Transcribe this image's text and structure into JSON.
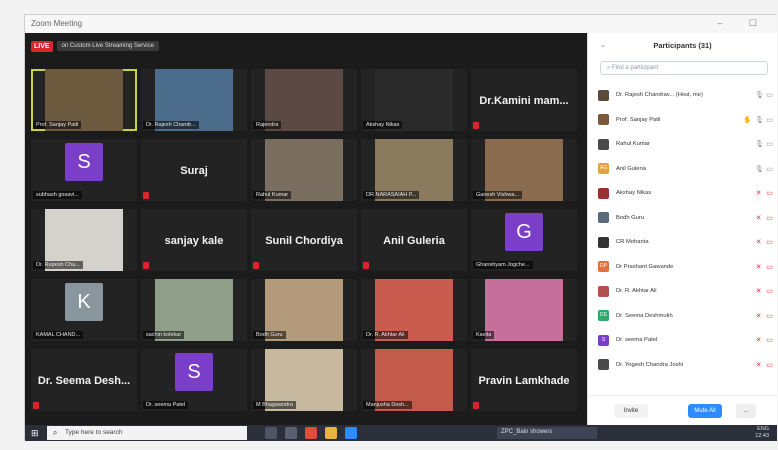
{
  "window": {
    "title": "Zoom Meeting"
  },
  "video": {
    "live_badge": "LIVE",
    "stream_label": "on Custom Live Streaming Service",
    "tiles": [
      {
        "kind": "video",
        "label": "Prof. Sanjay Patil",
        "active": true,
        "bg": "#6b5a3e"
      },
      {
        "kind": "video",
        "label": "Dr. Rajesh Chandr...",
        "bg": "#4b6c8a"
      },
      {
        "kind": "video",
        "label": "Rajendra",
        "bg": "#5b4a44"
      },
      {
        "kind": "video",
        "label": "Akshay Nikas",
        "bg": "#2a2a2a"
      },
      {
        "kind": "name",
        "label": "Dr.Kamini mam..."
      },
      {
        "kind": "avatar",
        "letter": "S",
        "color": "purple",
        "label": "subhash gosavi..."
      },
      {
        "kind": "name",
        "label": "Suraj"
      },
      {
        "kind": "video",
        "label": "Rahul Kumar",
        "bg": "#7a6e60"
      },
      {
        "kind": "video",
        "label": "DR.NARASAIAH P...",
        "bg": "#8a7b5e"
      },
      {
        "kind": "video",
        "label": "Ganesh Vishwa...",
        "bg": "#8b6b4d"
      },
      {
        "kind": "video",
        "label": "Dr. Rupesh Cha...",
        "bg": "#d4d2cc"
      },
      {
        "kind": "name",
        "label": "sanjay kale"
      },
      {
        "kind": "name",
        "label": "Sunil Chordiya"
      },
      {
        "kind": "name",
        "label": "Anil Guleria"
      },
      {
        "kind": "avatar",
        "letter": "G",
        "color": "purple",
        "label": "Ghanshyam Jogche..."
      },
      {
        "kind": "avatar",
        "letter": "K",
        "color": "grey",
        "label": "KAMAL CHAND..."
      },
      {
        "kind": "video",
        "label": "sachin kolekar",
        "bg": "#8f9f8a"
      },
      {
        "kind": "video",
        "label": "Bodh Guru",
        "bg": "#b39a7a"
      },
      {
        "kind": "video",
        "label": "Dr. R. Akhtar Ali",
        "bg": "#c95c4e"
      },
      {
        "kind": "video",
        "label": "Kavita",
        "bg": "#c66f9a"
      },
      {
        "kind": "name",
        "label": "Dr. Seema Desh..."
      },
      {
        "kind": "avatar",
        "letter": "S",
        "color": "purple",
        "label": "Dr. seema Patel"
      },
      {
        "kind": "video",
        "label": "M Bhagwandra",
        "bg": "#c7b8a0"
      },
      {
        "kind": "video",
        "label": "Manjusha Desh...",
        "bg": "#c25b4a"
      },
      {
        "kind": "name",
        "label": "Pravin Lamkhade"
      }
    ]
  },
  "panel": {
    "title": "Participants (31)",
    "search_placeholder": "Find a participant",
    "participants": [
      {
        "name": "Dr. Rajesh Chandrav... (Host, me)",
        "pic": "#5a4a3a",
        "mic": "on",
        "cam": "on"
      },
      {
        "name": "Prof. Sanjay Patil",
        "pic": "#7a5a3a",
        "hand": true,
        "mic": "on",
        "cam": "on"
      },
      {
        "name": "Rahul Kumar",
        "pic": "#4a4a4a",
        "mic": "on",
        "cam": "on"
      },
      {
        "name": "Anil Guleria",
        "pic": "#e6a23c",
        "initials": "AG",
        "mic": "on",
        "cam": "on"
      },
      {
        "name": "Akshay Nikas",
        "pic": "#9a3030",
        "mic": "off",
        "cam": "off"
      },
      {
        "name": "Bodh Guru",
        "pic": "#5a6a7a",
        "mic": "off",
        "cam": "off"
      },
      {
        "name": "CR Mohanta",
        "pic": "#333333",
        "mic": "off",
        "cam": "off"
      },
      {
        "name": "Dr Prashant Gawande",
        "pic": "#e0703c",
        "initials": "DP",
        "mic": "off",
        "cam": "off"
      },
      {
        "name": "Dr. R. Akhtar Ali",
        "pic": "#b05050",
        "mic": "off",
        "cam": "off"
      },
      {
        "name": "Dr. Seema Deshmukh",
        "pic": "#2fa86a",
        "initials": "DS",
        "mic": "off",
        "cam": "off"
      },
      {
        "name": "Dr. seema Patel",
        "pic": "#7a3ec8",
        "initials": "S",
        "mic": "off",
        "cam": "off"
      },
      {
        "name": "Dr. Yogesh Chandra Joshi",
        "pic": "#4a4a4a",
        "mic": "off",
        "cam": "off"
      }
    ],
    "invite_label": "Invite",
    "mute_all_label": "Mute All",
    "more_label": "..."
  },
  "taskbar": {
    "search_placeholder": "Type here to search",
    "task_label": "ZPC_Bain showers",
    "time": "12:43",
    "lang": "ENG"
  },
  "colors": {
    "live": "#d8262c",
    "active_speaker": "#c9d33a",
    "mute_all": "#2d8cff"
  }
}
